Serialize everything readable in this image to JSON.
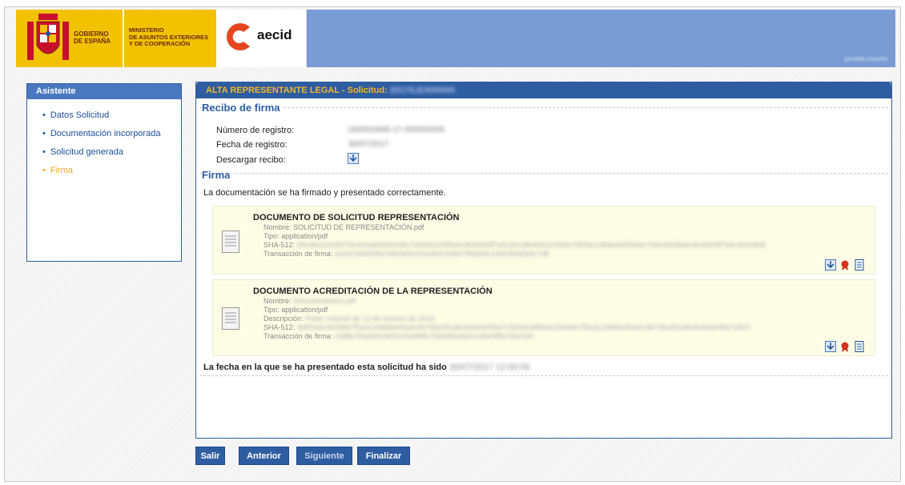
{
  "header": {
    "gobierno": "GOBIERNO\nDE ESPAÑA",
    "ministerio": "MINISTERIO\nDE ASUNTOS EXTERIORES\nY DE COOPERACIÓN",
    "aecid": "aecid",
    "user": "prueba.usuario"
  },
  "sidebar": {
    "title": "Asistente",
    "items": [
      {
        "label": "Datos Solicitud",
        "active": false
      },
      {
        "label": "Documentación incorporada",
        "active": false
      },
      {
        "label": "Solicitud generada",
        "active": false
      },
      {
        "label": "Firma",
        "active": true
      }
    ]
  },
  "main": {
    "header_label": "ALTA REPRESENTANTE LEGAL - Solicitud:",
    "header_solicitud": "2017/LE/000000",
    "recibo": {
      "title": "Recibo de firma",
      "numero_label": "Número de registro:",
      "numero_value": "O00002845-17-000000265",
      "fecha_label": "Fecha de registro:",
      "fecha_value": "30/07/2017",
      "descargar_label": "Descargar recibo:"
    },
    "firma": {
      "title": "Firma",
      "message": "La documentación se ha firmado y presentado correctamente."
    },
    "documents": [
      {
        "title": "DOCUMENTO DE SOLICITUD REPRESENTACIÓN",
        "nombre_label": "Nombre:",
        "nombre_value": "SOLICITUD DE REPRESENTACIÓN.pdf",
        "tipo_label": "Tipo:",
        "tipo_value": "application/pdf",
        "sha_label": "SHA-512:",
        "sha_value": "6f5c8e2a1b9d7f3e4c0a8b6d2e1f9c7a5b3d1e0f8a6c4b2d0e9f7a5c3b1d8e6f4a2c0b9e7d5f3a1c8b6e4d2f0a9c7b5e3d1f8a6c4e2b0d9f7a5c3e1b8d6",
        "tx_label": "Transacción de firma:",
        "tx_value": "a1b2c3d4e5f6a7b8c9d0e1f2a3b4c5d6e7f8a9b0c1d2e3f4a5b6c7d8"
      },
      {
        "title": "DOCUMENTO ACREDITACIÓN DE LA REPRESENTACIÓN",
        "nombre_label": "Nombre:",
        "nombre_value": "Documentacion.pdf",
        "tipo_label": "Tipo:",
        "tipo_value": "application/pdf",
        "desc_label": "Descripción:",
        "desc_value": "Poder notarial de 12 de octubre de 2016",
        "sha_label": "SHA-512:",
        "sha_value": "3e8f1a6c4b2d9e7f5a3c1b8d6e4f2a0c9b7d5e3f1a8c6b4d2e0f9a7c5b3d1e8f6a4c2b0d9e7f5a3c1b8d6e4f2a0c9b7d5e3f1a8c6b4d2e0f9a7c5b3",
        "tx_label": "Transacción de firma:",
        "tx_value": "c9d8e7f6a5b4c3d2e1f0a9b8c7d6e5f4a3b2c1d0e9f8a7b6c5d4"
      }
    ],
    "fecha_label": "La fecha en la que se ha presentado esta solicitud ha sido",
    "fecha_value": "30/07/2017 12:00:00"
  },
  "buttons": {
    "salir": "Salir",
    "anterior": "Anterior",
    "siguiente": "Siguiente",
    "finalizar": "Finalizar"
  },
  "colors": {
    "primary": "#2f5da1",
    "accent": "#f5a623",
    "header_bg": "#7a9cd4",
    "card_bg": "#fdfde6"
  },
  "icons": {
    "download": "download-icon",
    "cert": "certificate-icon",
    "document": "document-icon"
  }
}
